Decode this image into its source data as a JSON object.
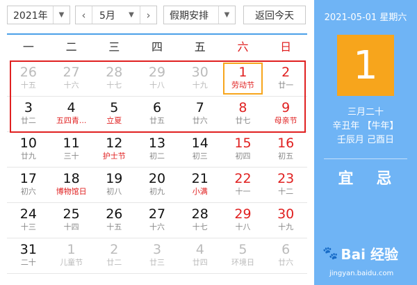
{
  "toolbar": {
    "year": "2021年",
    "month": "5月",
    "holiday": "假期安排",
    "today_button": "返回今天"
  },
  "weekdays": [
    "一",
    "二",
    "三",
    "四",
    "五",
    "六",
    "日"
  ],
  "weeks": [
    [
      {
        "d": "26",
        "s": "十五",
        "other": true
      },
      {
        "d": "27",
        "s": "十六",
        "other": true
      },
      {
        "d": "28",
        "s": "十七",
        "other": true
      },
      {
        "d": "29",
        "s": "十八",
        "other": true
      },
      {
        "d": "30",
        "s": "十九",
        "other": true
      },
      {
        "d": "1",
        "s": "劳动节",
        "wknd": true,
        "fest": true,
        "today": true
      },
      {
        "d": "2",
        "s": "廿一",
        "wknd": true
      }
    ],
    [
      {
        "d": "3",
        "s": "廿二"
      },
      {
        "d": "4",
        "s": "五四青...",
        "fest": true
      },
      {
        "d": "5",
        "s": "立夏",
        "fest": true
      },
      {
        "d": "6",
        "s": "廿五"
      },
      {
        "d": "7",
        "s": "廿六"
      },
      {
        "d": "8",
        "s": "廿七",
        "wknd": true
      },
      {
        "d": "9",
        "s": "母亲节",
        "wknd": true,
        "fest": true
      }
    ],
    [
      {
        "d": "10",
        "s": "廿九"
      },
      {
        "d": "11",
        "s": "三十"
      },
      {
        "d": "12",
        "s": "护士节",
        "fest": true
      },
      {
        "d": "13",
        "s": "初二"
      },
      {
        "d": "14",
        "s": "初三"
      },
      {
        "d": "15",
        "s": "初四",
        "wknd": true
      },
      {
        "d": "16",
        "s": "初五",
        "wknd": true
      }
    ],
    [
      {
        "d": "17",
        "s": "初六"
      },
      {
        "d": "18",
        "s": "博物馆日",
        "fest": true
      },
      {
        "d": "19",
        "s": "初八"
      },
      {
        "d": "20",
        "s": "初九"
      },
      {
        "d": "21",
        "s": "小满",
        "fest": true
      },
      {
        "d": "22",
        "s": "十一",
        "wknd": true
      },
      {
        "d": "23",
        "s": "十二",
        "wknd": true
      }
    ],
    [
      {
        "d": "24",
        "s": "十三"
      },
      {
        "d": "25",
        "s": "十四"
      },
      {
        "d": "26",
        "s": "十五"
      },
      {
        "d": "27",
        "s": "十六"
      },
      {
        "d": "28",
        "s": "十七"
      },
      {
        "d": "29",
        "s": "十八",
        "wknd": true
      },
      {
        "d": "30",
        "s": "十九",
        "wknd": true
      }
    ],
    [
      {
        "d": "31",
        "s": "二十"
      },
      {
        "d": "1",
        "s": "儿童节",
        "other": true
      },
      {
        "d": "2",
        "s": "廿二",
        "other": true
      },
      {
        "d": "3",
        "s": "廿三",
        "other": true
      },
      {
        "d": "4",
        "s": "廿四",
        "other": true
      },
      {
        "d": "5",
        "s": "环境日",
        "other": true
      },
      {
        "d": "6",
        "s": "廿六",
        "other": true
      }
    ]
  ],
  "side": {
    "date_line": "2021-05-01 星期六",
    "day": "1",
    "lunar_date": "三月二十",
    "year_gz": "辛丑年 【牛年】",
    "month_day_gz": "壬辰月 己酉日",
    "yi": "宜",
    "ji": "忌",
    "watermark": "Bai 经验",
    "watermark_sub": "jingyan.baidu.com"
  }
}
